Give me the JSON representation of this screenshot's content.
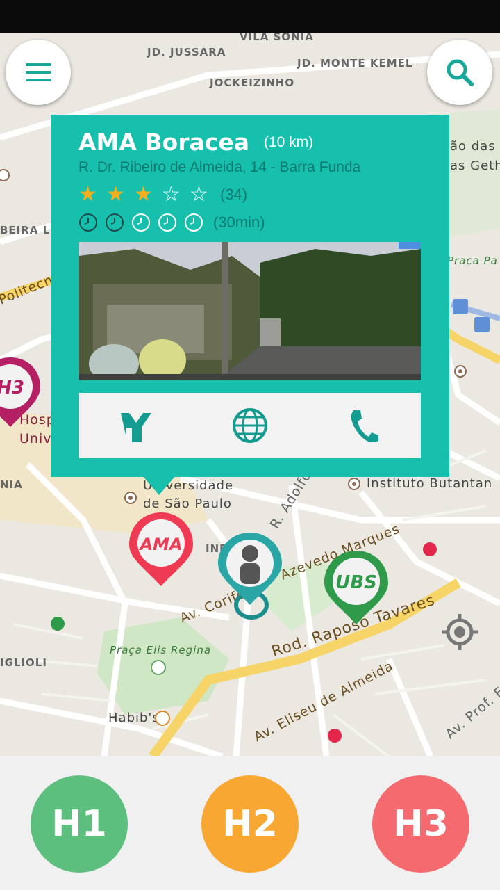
{
  "map": {
    "labels": {
      "vila_sonia": "VILA SONIA",
      "jd_jussara": "JD. JUSSARA",
      "jd_monte_kemel": "JD. MONTE KEMEL",
      "jockeizinho": "JOCKEIZINHO",
      "universidade": "Universidade",
      "de_sao_paulo": "de São Paulo",
      "instituto_butantan": "Instituto Butantan",
      "av_corifeu": "Av. Corifeu",
      "azevedo_marques": "Azevedo Marques",
      "rod_raposo_tavares": "Rod. Raposo Tavares",
      "av_eliseu": "Av. Eliseu de Almeida",
      "praca_elis_regina": "Praça Elis Regina",
      "habibs": "Habib's",
      "hosp": "Hosp",
      "univ": "Univ",
      "praca_pa": "Praça Pa",
      "politecn": "Politecn",
      "igliol": "IGLIOLI",
      "beira": "BEIRA LI",
      "nia": "NIA",
      "r_adolfo": "R. Adolfo",
      "da_s": "ão das M",
      "geth": "as Geth",
      "av_prof": "Av. Prof. Fra",
      "ind": "INDA"
    }
  },
  "buttons": {
    "menu": "menu-icon",
    "search": "search-icon",
    "locate": "crosshair-icon"
  },
  "card": {
    "title": "AMA Boracea",
    "distance": "(10 km)",
    "address": "R. Dr. Ribeiro de Almeida, 14 - Barra Funda",
    "rating": 3,
    "rating_max": 5,
    "rating_count": "(34)",
    "wait_icons": 5,
    "wait_text": "(30min)",
    "actions": [
      {
        "name": "directions",
        "icon": "directions-icon"
      },
      {
        "name": "website",
        "icon": "globe-icon"
      },
      {
        "name": "call",
        "icon": "phone-icon"
      }
    ],
    "accent": "#17bfad"
  },
  "markers": {
    "ama": "AMA",
    "ubs": "UBS",
    "h3": "H3"
  },
  "bottom": {
    "h1": "H1",
    "h2": "H2",
    "h3": "H3",
    "h1_color": "#5cbf7e",
    "h2_color": "#f9a733",
    "h3_color": "#f56a6e"
  }
}
